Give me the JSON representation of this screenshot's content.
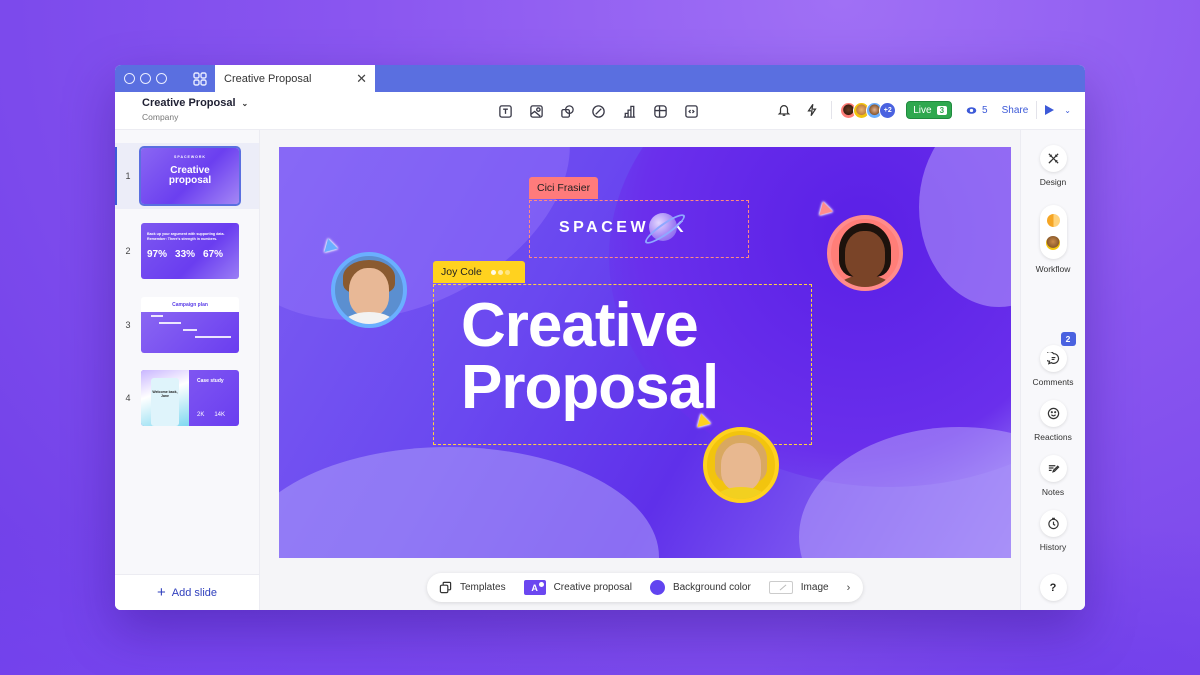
{
  "tabbar": {
    "tab_title": "Creative Proposal",
    "close_glyph": "✕"
  },
  "header": {
    "doc_title": "Creative Proposal",
    "doc_subtitle": "Company",
    "title_chevron": "⌄",
    "tools": [
      {
        "icon": "text-icon",
        "label": "Text"
      },
      {
        "icon": "image-icon",
        "label": "Image"
      },
      {
        "icon": "shapes-icon",
        "label": "Shapes"
      },
      {
        "icon": "sticker-icon",
        "label": "Sticker"
      },
      {
        "icon": "chart-icon",
        "label": "Chart"
      },
      {
        "icon": "table-icon",
        "label": "Table"
      },
      {
        "icon": "embed-icon",
        "label": "Embed"
      }
    ],
    "collaborators_more": "+2",
    "live_label": "Live",
    "live_count": "3",
    "viewer_count": "5",
    "share_label": "Share",
    "play_chevron": "⌄"
  },
  "sidebar": {
    "slides": [
      {
        "number": "1",
        "logo": "SPACEWORK",
        "title_line1": "Creative",
        "title_line2": "proposal",
        "active": true
      },
      {
        "number": "2",
        "text": "Back up your argument with supporting data. Remember: There's strength in numbers.",
        "stats": [
          "97%",
          "33%",
          "67%"
        ]
      },
      {
        "number": "3",
        "title": "Campaign plan"
      },
      {
        "number": "4",
        "title": "Case study",
        "phone_text": "Welcome back, Jane",
        "stats": [
          "2K",
          "14K"
        ]
      }
    ],
    "add_slide_label": "Add slide",
    "add_slide_icon": "+"
  },
  "canvas": {
    "logo_text": "SPACEW RK",
    "title_line1": "Creative",
    "title_line2": "Proposal",
    "collaborators": [
      {
        "name": "Cici Frasier",
        "color": "#ff7b7b"
      },
      {
        "name": "Joy Cole",
        "color": "#ffd21f"
      }
    ],
    "cursor_colors": {
      "blue": "#6aafff",
      "coral": "#ff8c8c",
      "yellow": "#ffd21f"
    }
  },
  "bottom_toolbar": {
    "templates_label": "Templates",
    "theme_chip": "A",
    "theme_label": "Creative proposal",
    "background_label": "Background color",
    "background_color": "#6144f0",
    "image_label": "Image",
    "next_glyph": "›"
  },
  "right_panel": {
    "design_label": "Design",
    "workflow_label": "Workflow",
    "comments_label": "Comments",
    "comments_badge": "2",
    "reactions_label": "Reactions",
    "notes_label": "Notes",
    "history_label": "History",
    "help_label": "?"
  },
  "colors": {
    "accent": "#3d5ad8",
    "tabbar": "#5a6fe0",
    "live_green": "#2fa84f",
    "slide_purple": "#6a48f0"
  }
}
